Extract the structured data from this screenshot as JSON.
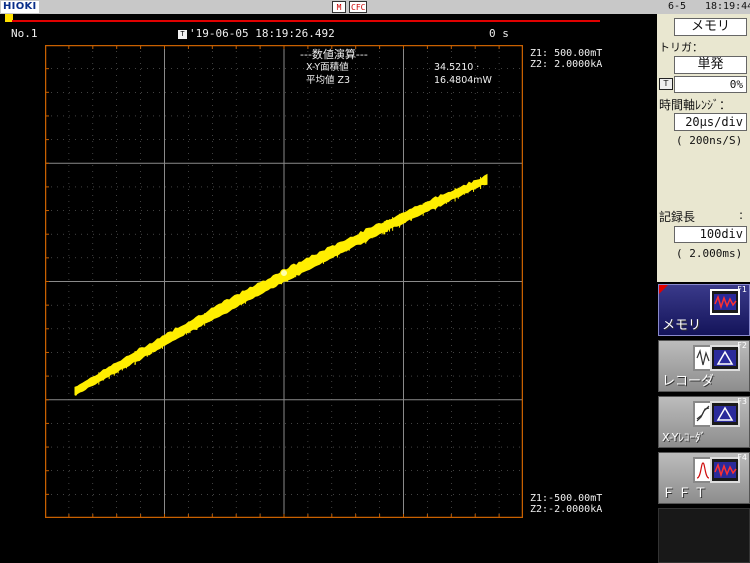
{
  "topbar": {
    "logo": "HIOKI",
    "status_icons": [
      "M",
      "CFC"
    ],
    "date": "6-5",
    "clock": "18:19:44"
  },
  "header": {
    "channel": "No.1",
    "trigger_time": "'19-06-05 18:19:26.492",
    "elapsed": "0 s"
  },
  "scales": {
    "top": "Z1: 500.00mT\nZ2: 2.0000kA",
    "bottom": "Z1:-500.00mT\nZ2:-2.0000kA"
  },
  "calc": {
    "title": "---数値演算---",
    "rows": [
      {
        "label": "X-Y面積値",
        "value": "34.5210 ·"
      },
      {
        "label": "  平均値 Z3",
        "value": "16.4804mW"
      }
    ]
  },
  "panel": {
    "title": "メモリ",
    "trigger_label": "トリガ：",
    "trigger_mode": "単発",
    "pretrigger": "0%",
    "timeaxis_label": "時間軸ﾚﾝｼﾞ：",
    "time_div": "20μs/div",
    "sampling": "( 200ns/S)",
    "record_len_label": "記録長",
    "record_len_colon": ":",
    "record_len": "100div",
    "record_time": "( 2.000ms)"
  },
  "fkeys": [
    {
      "num": "F1",
      "label": "メモリ",
      "icon": "memory-wave-icon",
      "active": true
    },
    {
      "num": "F2",
      "label": "レコーダ",
      "icon": "recorder-wave-icon",
      "active": false
    },
    {
      "num": "F3",
      "label": "X-Yﾚｺｰﾀﾞ",
      "icon": "xy-recorder-icon",
      "active": false
    },
    {
      "num": "F4",
      "label": "ＦＦＴ",
      "icon": "fft-spectrum-icon",
      "active": false
    }
  ],
  "colors": {
    "trace": "#ffee00",
    "grid": "#6a6a6a",
    "frame": "#c86000",
    "accent_red": "#e10000",
    "panel_bg": "#e9e7d0"
  }
}
